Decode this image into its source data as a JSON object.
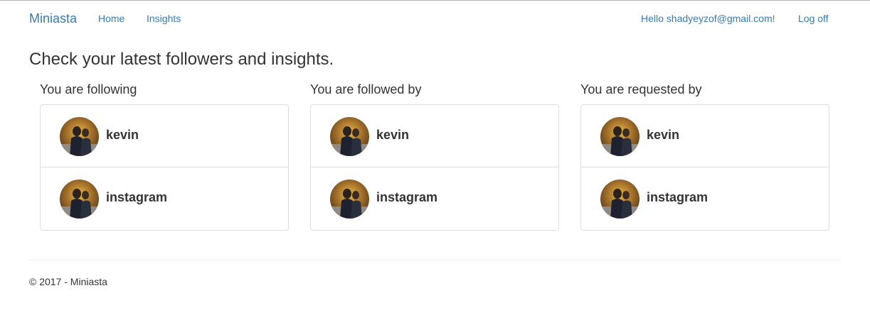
{
  "nav": {
    "brand": "Miniasta",
    "home": "Home",
    "insights": "Insights",
    "greeting": "Hello shadyeyzof@gmail.com!",
    "logoff": "Log off"
  },
  "page": {
    "title": "Check your latest followers and insights."
  },
  "columns": [
    {
      "title": "You are following",
      "users": [
        {
          "name": "kevin",
          "avatar": "avatar-icon"
        },
        {
          "name": "instagram",
          "avatar": "avatar-icon"
        }
      ]
    },
    {
      "title": "You are followed by",
      "users": [
        {
          "name": "kevin",
          "avatar": "avatar-icon"
        },
        {
          "name": "instagram",
          "avatar": "avatar-icon"
        }
      ]
    },
    {
      "title": "You are requested by",
      "users": [
        {
          "name": "kevin",
          "avatar": "avatar-icon"
        },
        {
          "name": "instagram",
          "avatar": "avatar-icon"
        }
      ]
    }
  ],
  "footer": {
    "text": "© 2017 - Miniasta"
  },
  "colors": {
    "link": "#337ab7",
    "text": "#333333",
    "border": "#dddddd"
  }
}
